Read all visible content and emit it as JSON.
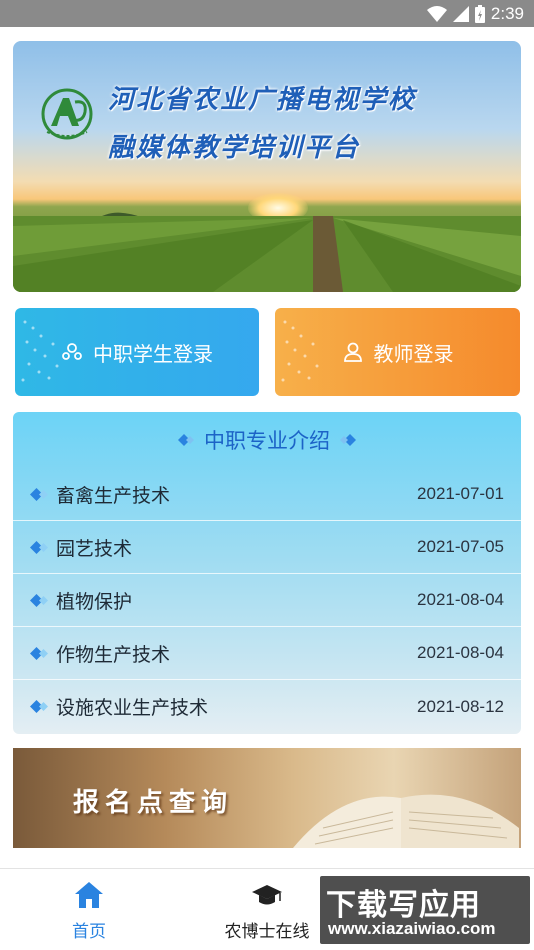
{
  "status_bar": {
    "time": "2:39"
  },
  "hero": {
    "title": "河北省农业广播电视学校",
    "subtitle": "融媒体教学培训平台"
  },
  "login": {
    "student_label": "中职学生登录",
    "teacher_label": "教师登录"
  },
  "majors": {
    "title": "中职专业介绍",
    "items": [
      {
        "name": "畜禽生产技术",
        "date": "2021-07-01"
      },
      {
        "name": "园艺技术",
        "date": "2021-07-05"
      },
      {
        "name": "植物保护",
        "date": "2021-08-04"
      },
      {
        "name": "作物生产技术",
        "date": "2021-08-04"
      },
      {
        "name": "设施农业生产技术",
        "date": "2021-08-12"
      }
    ]
  },
  "query": {
    "label": "报名点查询"
  },
  "bottom_nav": {
    "items": [
      {
        "label": "首页",
        "icon": "home-icon",
        "active": true
      },
      {
        "label": "农博士在线",
        "icon": "graduation-cap-icon",
        "active": false
      }
    ]
  },
  "watermark": {
    "main": "下载写应用",
    "url": "www.xiazaiwiao.com"
  },
  "colors": {
    "accent": "#2a83e0",
    "student_btn": "#35a8ee",
    "teacher_btn": "#f58a2c",
    "title_blue": "#1c63c7"
  }
}
